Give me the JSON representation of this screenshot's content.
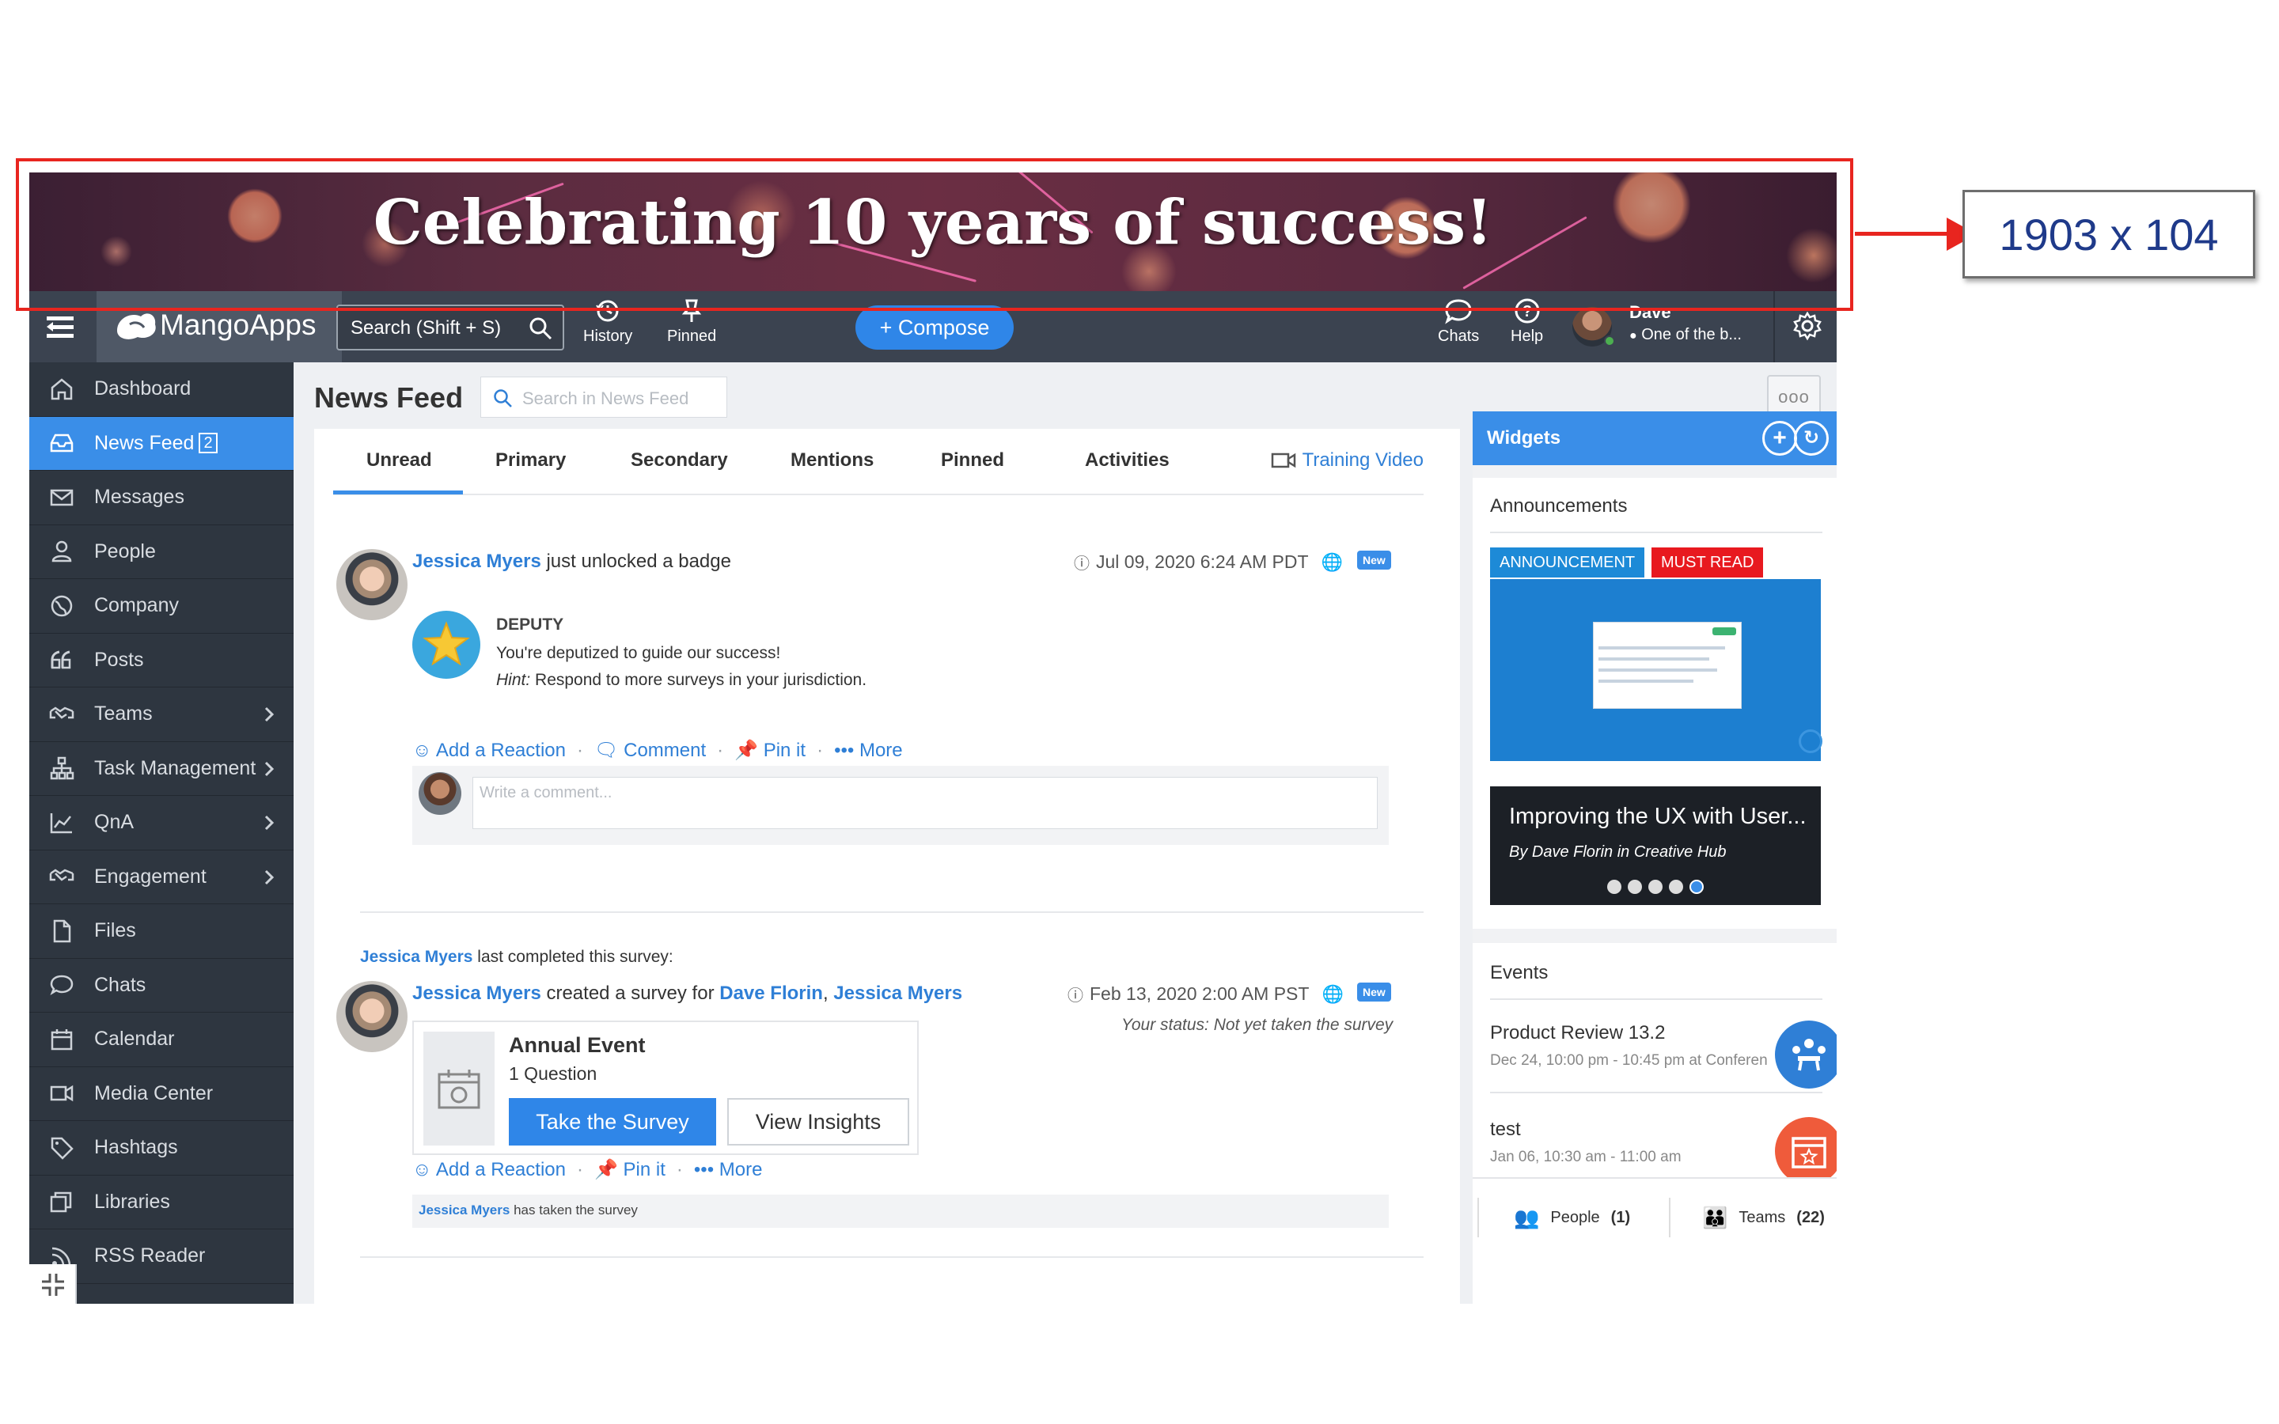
{
  "annotation": {
    "label": "1903 x 104",
    "frame_color": "#e8251f"
  },
  "banner": {
    "title": "Celebrating 10 years of success!"
  },
  "topbar": {
    "logo_text": "MangoApps",
    "search_label": "Search (Shift + S)",
    "history_label": "History",
    "pinned_label": "Pinned",
    "compose_label": "+ Compose",
    "chats_label": "Chats",
    "help_label": "Help",
    "user_name": "Dave",
    "user_status": "One of the b..."
  },
  "sidebar": {
    "items": [
      {
        "label": "Dashboard",
        "icon": "home-icon"
      },
      {
        "label": "News Feed",
        "badge": "2",
        "icon": "inbox-icon",
        "active": true
      },
      {
        "label": "Messages",
        "icon": "mail-icon"
      },
      {
        "label": "People",
        "icon": "person-icon"
      },
      {
        "label": "Company",
        "icon": "globe-icon"
      },
      {
        "label": "Posts",
        "icon": "quote-icon"
      },
      {
        "label": "Teams",
        "icon": "handshake-icon",
        "chevron": true
      },
      {
        "label": "Task Management",
        "icon": "org-chart-icon",
        "chevron": true
      },
      {
        "label": "QnA",
        "icon": "chart-icon",
        "chevron": true
      },
      {
        "label": "Engagement",
        "icon": "handshake-icon",
        "chevron": true
      },
      {
        "label": "Files",
        "icon": "file-icon"
      },
      {
        "label": "Chats",
        "icon": "chat-icon"
      },
      {
        "label": "Calendar",
        "icon": "calendar-icon"
      },
      {
        "label": "Media Center",
        "icon": "video-icon"
      },
      {
        "label": "Hashtags",
        "icon": "tag-icon"
      },
      {
        "label": "Libraries",
        "icon": "library-icon"
      },
      {
        "label": "RSS Reader",
        "icon": "rss-icon"
      }
    ]
  },
  "main": {
    "title": "News Feed",
    "search_placeholder": "Search in News Feed",
    "more_label": "ooo",
    "tabs": [
      "Unread",
      "Primary",
      "Secondary",
      "Mentions",
      "Pinned",
      "Activities"
    ],
    "training_label": "Training Video"
  },
  "post1": {
    "author": "Jessica Myers",
    "action": "just unlocked a badge",
    "time": "Jul 09, 2020 6:24 AM PDT",
    "new_label": "New",
    "badge_title": "DEPUTY",
    "badge_desc": "You're deputized to guide our success!",
    "hint_label": "Hint:",
    "hint_text": "Respond to more surveys in your jurisdiction.",
    "actions": {
      "reaction": "Add a Reaction",
      "comment": "Comment",
      "pin": "Pin it",
      "more": "More"
    },
    "comment_placeholder": "Write a comment..."
  },
  "post2": {
    "context_author": "Jessica Myers",
    "context_text": "last completed this survey:",
    "author": "Jessica Myers",
    "action": "created a survey for",
    "target1": "Dave Florin",
    "target_sep": ",",
    "target2": "Jessica Myers",
    "time": "Feb 13, 2020 2:00 AM PST",
    "new_label": "New",
    "status": "Your status: Not yet taken the survey",
    "survey_title": "Annual Event",
    "survey_questions": "1 Question",
    "take_label": "Take the Survey",
    "insights_label": "View Insights",
    "actions": {
      "reaction": "Add a Reaction",
      "pin": "Pin it",
      "more": "More"
    },
    "footer_author": "Jessica Myers",
    "footer_text": "has taken the survey"
  },
  "widgets": {
    "title": "Widgets",
    "announcements": {
      "title": "Announcements",
      "tag1": "ANNOUNCEMENT",
      "tag2": "MUST READ",
      "caption_title": "Improving the UX with User...",
      "caption_sub": "By Dave Florin in Creative Hub"
    },
    "events": {
      "title": "Events",
      "items": [
        {
          "name": "Product Review 13.2",
          "time": "Dec 24, 10:00 pm - 10:45 pm at Conferen",
          "color": "#2f7fd6"
        },
        {
          "name": "test",
          "time": "Jan 06, 10:30 am - 11:00 am",
          "color": "#ef5b3b"
        }
      ]
    },
    "people_label": "People",
    "people_count": "(1)",
    "teams_label": "Teams",
    "teams_count": "(22)"
  },
  "colors": {
    "accent": "#3a8ee8",
    "sidebar": "#2e3640",
    "topbar": "#3b4350",
    "must_read": "#e8191f"
  }
}
